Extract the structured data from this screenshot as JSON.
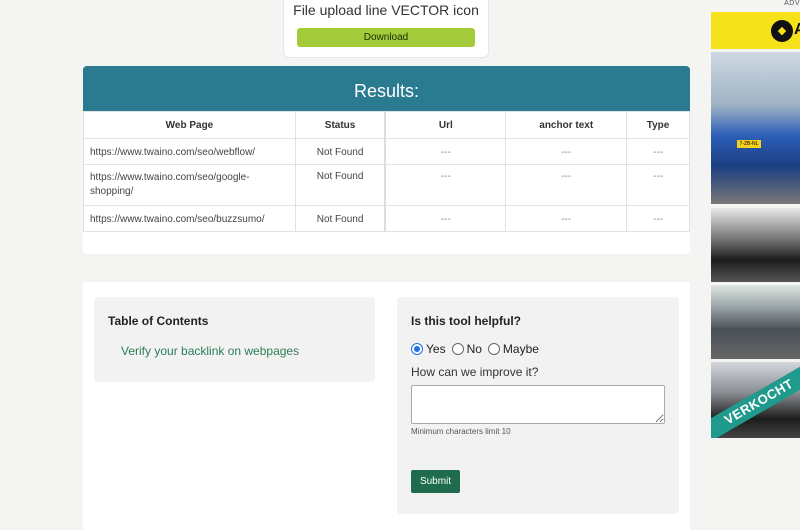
{
  "top_ad": {
    "title": "File upload line VECTOR icon",
    "download_label": "Download"
  },
  "results": {
    "title": "Results:",
    "columns": [
      "Web Page",
      "Status",
      "Url",
      "anchor text",
      "Type"
    ],
    "rows": [
      [
        "https://www.twaino.com/seo/webflow/",
        "Not Found",
        "---",
        "---",
        "---"
      ],
      [
        "https://www.twaino.com/seo/google-shopping/",
        "Not Found",
        "---",
        "---",
        "---"
      ],
      [
        "https://www.twaino.com/seo/buzzsumo/",
        "Not Found",
        "---",
        "---",
        "---"
      ]
    ]
  },
  "toc": {
    "title": "Table of Contents",
    "link": "Verify your backlink on webpages"
  },
  "feedback": {
    "question": "Is this tool helpful?",
    "options": [
      "Yes",
      "No",
      "Maybe"
    ],
    "selected": "Yes",
    "improve_label": "How can we improve it?",
    "textarea_value": "",
    "min_chars": "Minimum characters limit 10",
    "submit_label": "Submit"
  },
  "side_ad": {
    "label": "ADV",
    "brand_letter": "A",
    "plate": "7-ZB-NL",
    "banner": "VERKOCHT"
  },
  "colors": {
    "results_header": "#2a7b8f",
    "download_button": "#a4cc3a",
    "submit_button": "#1e6b4e",
    "toc_link": "#2e7d56",
    "ad_yellow": "#f6e21a"
  }
}
